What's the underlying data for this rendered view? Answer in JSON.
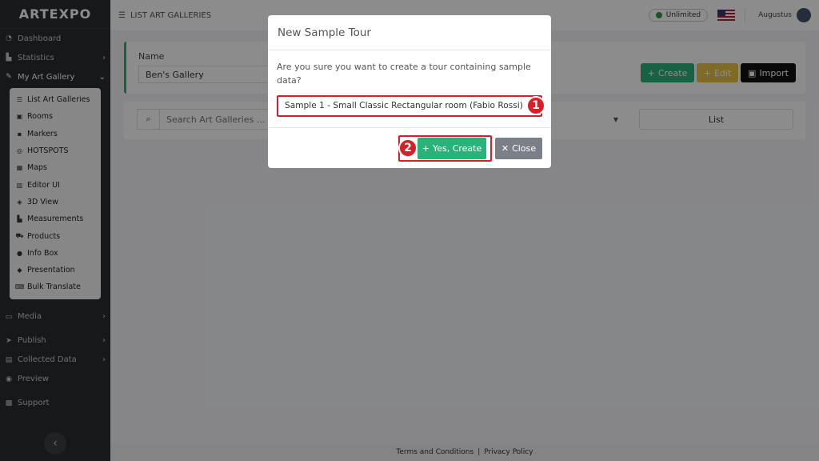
{
  "brand": "ARTEXPO",
  "sidebar": {
    "items_top": [
      {
        "label": "Dashboard",
        "icon": "dashboard-icon"
      },
      {
        "label": "Statistics",
        "icon": "statistics-icon",
        "chevron": true
      },
      {
        "label": "My Art Gallery",
        "icon": "gallery-icon",
        "chevron": true
      }
    ],
    "submenu": [
      {
        "label": "List Art Galleries",
        "icon": "list-icon"
      },
      {
        "label": "Rooms",
        "icon": "rooms-icon"
      },
      {
        "label": "Markers",
        "icon": "markers-icon"
      },
      {
        "label": "HOTSPOTS",
        "icon": "hotspots-icon"
      },
      {
        "label": "Maps",
        "icon": "maps-icon"
      },
      {
        "label": "Editor UI",
        "icon": "editor-icon"
      },
      {
        "label": "3D View",
        "icon": "cube-icon"
      },
      {
        "label": "Measurements",
        "icon": "measurements-icon"
      },
      {
        "label": "Products",
        "icon": "cart-icon"
      },
      {
        "label": "Info Box",
        "icon": "info-icon"
      },
      {
        "label": "Presentation",
        "icon": "presentation-icon"
      },
      {
        "label": "Bulk Translate",
        "icon": "translate-icon"
      }
    ],
    "items_bottom": [
      {
        "label": "Media",
        "icon": "media-icon",
        "chevron": true
      },
      {
        "label": "Publish",
        "icon": "publish-icon",
        "chevron": true
      },
      {
        "label": "Collected Data",
        "icon": "data-icon",
        "chevron": true
      },
      {
        "label": "Preview",
        "icon": "eye-icon"
      },
      {
        "label": "Support",
        "icon": "support-icon"
      }
    ],
    "collapse": "‹"
  },
  "topbar": {
    "breadcrumb": "LIST ART GALLERIES",
    "plan": "Unlimited",
    "user": "Augustus"
  },
  "main": {
    "name_label": "Name",
    "name_value": "Ben's Gallery",
    "create_label": "Create",
    "edit_label": "Edit",
    "import_label": "Import",
    "search_placeholder": "Search Art Galleries ...",
    "list_label": "List"
  },
  "footer": {
    "terms": "Terms and Conditions",
    "sep": "|",
    "privacy": "Privacy Policy"
  },
  "modal": {
    "title": "New Sample Tour",
    "message": "Are you sure you want to create a tour containing sample data?",
    "selected_option": "Sample 1 - Small Classic Rectangular room (Fabio Rossi)",
    "yes_label": "Yes, Create",
    "close_label": "Close",
    "step1": "1",
    "step2": "2"
  },
  "colors": {
    "accent_green": "#2ab27b",
    "edit_yellow": "#e6c34a",
    "highlight_red": "#d61f26",
    "sidebar_bg": "#2b2d31"
  }
}
